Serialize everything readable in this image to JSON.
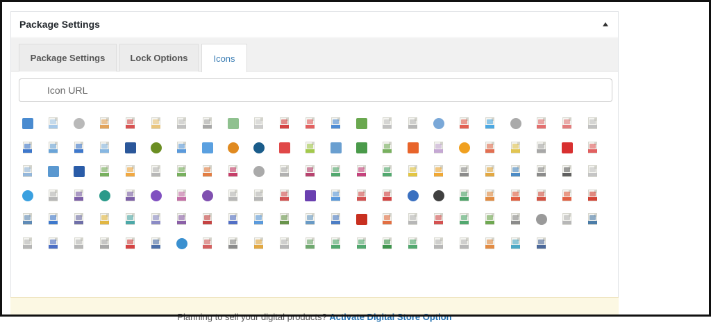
{
  "panel": {
    "title": "Package Settings"
  },
  "tabs": [
    {
      "label": "Package Settings",
      "active": false
    },
    {
      "label": "Lock Options",
      "active": false
    },
    {
      "label": "Icons",
      "active": true
    }
  ],
  "search": {
    "placeholder": "Icon URL"
  },
  "icons": [
    {
      "name": "folder-icon",
      "style": "square",
      "color": "#4a8bd0"
    },
    {
      "name": "file-generic-icon",
      "style": "doc",
      "color": "#9fc4e8"
    },
    {
      "name": "disc-icon",
      "style": "round",
      "color": "#b9b9b9"
    },
    {
      "name": "file-aac-icon",
      "style": "doc",
      "color": "#e09a4a"
    },
    {
      "name": "acrobat-icon",
      "style": "doc",
      "color": "#d44040"
    },
    {
      "name": "file-ai-icon",
      "style": "doc",
      "color": "#e8c070"
    },
    {
      "name": "zip-icon",
      "style": "doc",
      "color": "#bbbbbb"
    },
    {
      "name": "file-asx-icon",
      "style": "doc",
      "color": "#a0a0a0"
    },
    {
      "name": "download-icon",
      "style": "square",
      "color": "#8fc18f"
    },
    {
      "name": "music-icon",
      "style": "doc",
      "color": "#c8c8c8"
    },
    {
      "name": "film-icon",
      "style": "doc",
      "color": "#d03030"
    },
    {
      "name": "file-avi-icon",
      "style": "doc",
      "color": "#e05050"
    },
    {
      "name": "image-icon",
      "style": "doc",
      "color": "#3b7fd0"
    },
    {
      "name": "install-icon",
      "style": "square",
      "color": "#6aa84f"
    },
    {
      "name": "zip2-icon",
      "style": "doc",
      "color": "#bbbbbb"
    },
    {
      "name": "zip3-icon",
      "style": "doc",
      "color": "#b0b0b0"
    },
    {
      "name": "cloud-icon",
      "style": "round",
      "color": "#7aa8d8"
    },
    {
      "name": "code-icon",
      "style": "doc",
      "color": "#e05040"
    },
    {
      "name": "css-icon",
      "style": "doc",
      "color": "#3aa0e0"
    },
    {
      "name": "cd-icon",
      "style": "round",
      "color": "#aaaaaa"
    },
    {
      "name": "file-cvs-icon",
      "style": "doc",
      "color": "#e06060"
    },
    {
      "name": "file-dat-icon",
      "style": "doc",
      "color": "#e07070"
    },
    {
      "name": "zip4-icon",
      "style": "doc",
      "color": "#bbbbbb"
    },
    {
      "name": "word-doc-icon",
      "style": "doc",
      "color": "#2a6ac8"
    },
    {
      "name": "file-docx-icon",
      "style": "doc",
      "color": "#5b9bd5"
    },
    {
      "name": "word-doc2-icon",
      "style": "doc",
      "color": "#2a6ac8"
    },
    {
      "name": "file-dot-icon",
      "style": "doc",
      "color": "#7bb0e0"
    },
    {
      "name": "word-icon",
      "style": "square",
      "color": "#2b579a"
    },
    {
      "name": "database-icon",
      "style": "round",
      "color": "#6b8e23"
    },
    {
      "name": "download-doc-icon",
      "style": "doc",
      "color": "#4a90d9"
    },
    {
      "name": "download-box-icon",
      "style": "square",
      "color": "#5aa0e0"
    },
    {
      "name": "badge-icon",
      "style": "round",
      "color": "#e08a20"
    },
    {
      "name": "camera-icon",
      "style": "round",
      "color": "#1a5c8a"
    },
    {
      "name": "down-arrow-icon",
      "style": "square",
      "color": "#e04848"
    },
    {
      "name": "android-icon",
      "style": "doc",
      "color": "#9ac43a"
    },
    {
      "name": "monitor-icon",
      "style": "square",
      "color": "#6a9fd0"
    },
    {
      "name": "books-icon",
      "style": "square",
      "color": "#4a9a4a"
    },
    {
      "name": "install2-icon",
      "style": "doc",
      "color": "#6aa84f"
    },
    {
      "name": "folder-orange-icon",
      "style": "square",
      "color": "#e8642a"
    },
    {
      "name": "file-eps-icon",
      "style": "doc",
      "color": "#c0a0d0"
    },
    {
      "name": "ring-icon",
      "style": "round",
      "color": "#f0a020"
    },
    {
      "name": "file-exe-icon",
      "style": "doc",
      "color": "#e06040"
    },
    {
      "name": "file-fla-icon",
      "style": "doc",
      "color": "#e0c040"
    },
    {
      "name": "file-code-icon",
      "style": "doc",
      "color": "#a0a0a0"
    },
    {
      "name": "flash-icon",
      "style": "square",
      "color": "#d83030"
    },
    {
      "name": "file-fla2-icon",
      "style": "doc",
      "color": "#e05050"
    },
    {
      "name": "file-flac-icon",
      "style": "doc",
      "color": "#8ab0d8"
    },
    {
      "name": "image-landscape-icon",
      "style": "square",
      "color": "#5a98d0"
    },
    {
      "name": "window-icon",
      "style": "square",
      "color": "#2a5ca8"
    },
    {
      "name": "gif-icon",
      "style": "doc",
      "color": "#6aa84f"
    },
    {
      "name": "file-gif-icon",
      "style": "doc",
      "color": "#f0a030"
    },
    {
      "name": "zip5-icon",
      "style": "doc",
      "color": "#b0b0b0"
    },
    {
      "name": "file-htm-icon",
      "style": "doc",
      "color": "#6aa84f"
    },
    {
      "name": "file-html-icon",
      "style": "doc",
      "color": "#e07030"
    },
    {
      "name": "file-ico-icon",
      "style": "doc",
      "color": "#c02a5a"
    },
    {
      "name": "file-iso-icon",
      "style": "round",
      "color": "#aaaaaa"
    },
    {
      "name": "file-dmg-icon",
      "style": "doc",
      "color": "#aaaaaa"
    },
    {
      "name": "file-jpg-icon",
      "style": "doc",
      "color": "#b03060"
    },
    {
      "name": "file-jpeg-icon",
      "style": "doc",
      "color": "#40a060"
    },
    {
      "name": "file-jar-icon",
      "style": "doc",
      "color": "#c03070"
    },
    {
      "name": "file-png-icon",
      "style": "doc",
      "color": "#40a060"
    },
    {
      "name": "file-js-icon",
      "style": "doc",
      "color": "#e0c030"
    },
    {
      "name": "file-json-icon",
      "style": "doc",
      "color": "#f0a020"
    },
    {
      "name": "file-brackets-icon",
      "style": "doc",
      "color": "#808080"
    },
    {
      "name": "file-log-icon",
      "style": "doc",
      "color": "#e0a030"
    },
    {
      "name": "file-m4a-icon",
      "style": "doc",
      "color": "#3a80c0"
    },
    {
      "name": "file-mdb-icon",
      "style": "doc",
      "color": "#808080"
    },
    {
      "name": "music-note-icon",
      "style": "doc",
      "color": "#505050"
    },
    {
      "name": "file-mid-icon",
      "style": "doc",
      "color": "#c0c0c0"
    },
    {
      "name": "file-mov-icon",
      "style": "round",
      "color": "#3aa0e0"
    },
    {
      "name": "file-mp4-icon",
      "style": "doc",
      "color": "#b0b0b0"
    },
    {
      "name": "file-mp2-icon",
      "style": "doc",
      "color": "#7050a0"
    },
    {
      "name": "headphones-icon",
      "style": "round",
      "color": "#2a9a8a"
    },
    {
      "name": "file-mp3-icon",
      "style": "doc",
      "color": "#7050a0"
    },
    {
      "name": "player-icon",
      "style": "round",
      "color": "#8050c0"
    },
    {
      "name": "file-mpeg-icon",
      "style": "doc",
      "color": "#c060a0"
    },
    {
      "name": "media-icon",
      "style": "round",
      "color": "#8050b0"
    },
    {
      "name": "zip6-icon",
      "style": "doc",
      "color": "#b0b0b0"
    },
    {
      "name": "file-nfo-icon",
      "style": "doc",
      "color": "#b0b0b0"
    },
    {
      "name": "file-nrg-icon",
      "style": "doc",
      "color": "#d04040"
    },
    {
      "name": "chip-icon",
      "style": "square",
      "color": "#6a40b0"
    },
    {
      "name": "pdf-icon",
      "style": "doc",
      "color": "#4a90d9"
    },
    {
      "name": "file-pdf-red-icon",
      "style": "doc",
      "color": "#d04040"
    },
    {
      "name": "file-pdf-icon",
      "style": "doc",
      "color": "#d03030"
    },
    {
      "name": "gears-icon",
      "style": "round",
      "color": "#3a70c0"
    },
    {
      "name": "puzzle-icon",
      "style": "round",
      "color": "#404040"
    },
    {
      "name": "file-pic-icon",
      "style": "doc",
      "color": "#3a9a5a"
    },
    {
      "name": "file-pn-icon",
      "style": "doc",
      "color": "#e08030"
    },
    {
      "name": "file-ppt-icon",
      "style": "doc",
      "color": "#e05030"
    },
    {
      "name": "file-pps-icon",
      "style": "doc",
      "color": "#d04030"
    },
    {
      "name": "file-pps2-icon",
      "style": "doc",
      "color": "#e05030"
    },
    {
      "name": "powerpoint-icon",
      "style": "doc",
      "color": "#d03020"
    },
    {
      "name": "file-ps-icon",
      "style": "doc",
      "color": "#5080b0"
    },
    {
      "name": "file-psd-icon",
      "style": "doc",
      "color": "#2a6ac8"
    },
    {
      "name": "file-pub-icon",
      "style": "doc",
      "color": "#6060a0"
    },
    {
      "name": "quicktime-icon",
      "style": "doc",
      "color": "#e0b030"
    },
    {
      "name": "file-qt-icon",
      "style": "doc",
      "color": "#3aa0a0"
    },
    {
      "name": "file-ra-icon",
      "style": "doc",
      "color": "#8080c0"
    },
    {
      "name": "file-rar-icon",
      "style": "doc",
      "color": "#8050a0"
    },
    {
      "name": "file-rar2-icon",
      "style": "doc",
      "color": "#c03030"
    },
    {
      "name": "file-rm-icon",
      "style": "doc",
      "color": "#4060c0"
    },
    {
      "name": "contact-icon",
      "style": "doc",
      "color": "#4a90d9"
    },
    {
      "name": "file-rtf-icon",
      "style": "doc",
      "color": "#5a8a3a"
    },
    {
      "name": "file-sql-icon",
      "style": "doc",
      "color": "#5a90c0"
    },
    {
      "name": "settings-file-icon",
      "style": "doc",
      "color": "#3a70c0"
    },
    {
      "name": "swf-icon",
      "style": "square",
      "color": "#c83020"
    },
    {
      "name": "file-svg-icon",
      "style": "doc",
      "color": "#e06030"
    },
    {
      "name": "zip7-icon",
      "style": "doc",
      "color": "#b0b0b0"
    },
    {
      "name": "file-tga-icon",
      "style": "doc",
      "color": "#d04040"
    },
    {
      "name": "file-tiff-icon",
      "style": "doc",
      "color": "#40a060"
    },
    {
      "name": "file-tmp-icon",
      "style": "doc",
      "color": "#60a040"
    },
    {
      "name": "file-ttf-icon",
      "style": "doc",
      "color": "#808080"
    },
    {
      "name": "cd2-icon",
      "style": "round",
      "color": "#9a9a9a"
    },
    {
      "name": "file-txt-icon",
      "style": "doc",
      "color": "#b0b0b0"
    },
    {
      "name": "file-vcf-icon",
      "style": "doc",
      "color": "#3a70a0"
    },
    {
      "name": "file-vob-icon",
      "style": "doc",
      "color": "#b0b0b0"
    },
    {
      "name": "file-vsd-icon",
      "style": "doc",
      "color": "#3a60c0"
    },
    {
      "name": "file-wav-icon",
      "style": "doc",
      "color": "#b0b0b0"
    },
    {
      "name": "file-wave-icon",
      "style": "doc",
      "color": "#a0a0a0"
    },
    {
      "name": "audio-wave-icon",
      "style": "doc",
      "color": "#d03030"
    },
    {
      "name": "file-wav2-icon",
      "style": "doc",
      "color": "#3a60a0"
    },
    {
      "name": "globe-icon",
      "style": "round",
      "color": "#3a90d0"
    },
    {
      "name": "speaker-icon",
      "style": "doc",
      "color": "#d05050"
    },
    {
      "name": "file-wma-icon",
      "style": "doc",
      "color": "#808080"
    },
    {
      "name": "film-strip-icon",
      "style": "doc",
      "color": "#e0a030"
    },
    {
      "name": "file-wmv-icon",
      "style": "doc",
      "color": "#b0b0b0"
    },
    {
      "name": "file-wpd-icon",
      "style": "doc",
      "color": "#60a060"
    },
    {
      "name": "file-xls-icon",
      "style": "doc",
      "color": "#40a060"
    },
    {
      "name": "file-xlsx-icon",
      "style": "doc",
      "color": "#40a060"
    },
    {
      "name": "excel-icon",
      "style": "doc",
      "color": "#2a8a3a"
    },
    {
      "name": "file-xlt-icon",
      "style": "doc",
      "color": "#40a060"
    },
    {
      "name": "file-xml-icon",
      "style": "doc",
      "color": "#b0b0b0"
    },
    {
      "name": "file-xpi-icon",
      "style": "doc",
      "color": "#b0b0b0"
    },
    {
      "name": "file-xsl-icon",
      "style": "doc",
      "color": "#e08030"
    },
    {
      "name": "zipper-icon",
      "style": "doc",
      "color": "#3aa0c0"
    },
    {
      "name": "file-zip-icon",
      "style": "doc",
      "color": "#3a5a90"
    }
  ],
  "notice": {
    "text": "Planning to sell your digital products?",
    "link": "Activate Digital Store Option"
  }
}
